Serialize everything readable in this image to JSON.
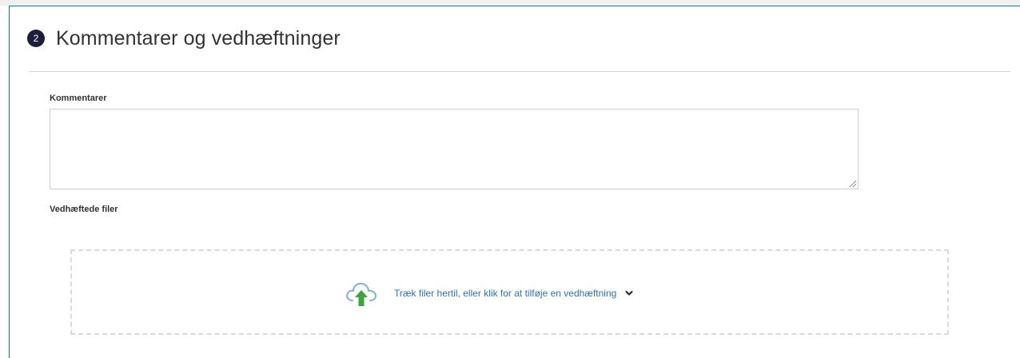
{
  "section": {
    "step_number": "2",
    "title": "Kommentarer og vedhæftninger"
  },
  "comments": {
    "label": "Kommentarer",
    "value": "",
    "placeholder": ""
  },
  "attachments": {
    "label": "Vedhæftede filer",
    "dropzone_text": "Træk filer hertil, eller klik for at tilføje en vedhæftning",
    "upload_icon": "cloud-upload-icon",
    "expand_icon": "chevron-down-icon"
  },
  "colors": {
    "accent_border": "#0078d4",
    "badge_bg": "#1b1f3a",
    "link_text": "#2b73b5",
    "upload_arrow": "#3aa639"
  }
}
